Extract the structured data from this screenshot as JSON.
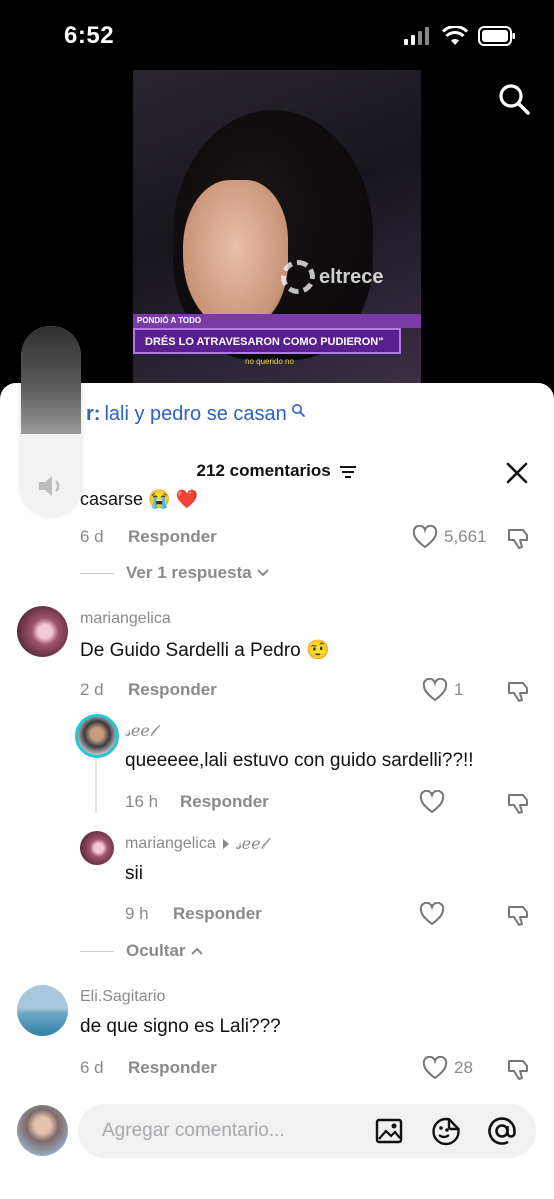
{
  "status_bar": {
    "time": "6:52"
  },
  "video": {
    "channel_logo": "eltrece",
    "banner_top": "PONDIÓ A TODO",
    "banner_main": "DRÉS LO ATRAVESARON COMO PUDIERON\"",
    "subtitle": "no querido no"
  },
  "volume": {
    "level": 0.43
  },
  "search_suggestion": {
    "prefix": "r:",
    "query": "lali y pedro se casan"
  },
  "sheet": {
    "title": "212 comentarios",
    "cut_text": "casarse 😭 ❤️"
  },
  "comments": [
    {
      "partial": true,
      "time": "6 d",
      "reply_label": "Responder",
      "likes": "5,661",
      "view_replies": "Ver 1 respuesta"
    },
    {
      "username": "mariangelica",
      "text": "De Guido Sardelli a Pedro 🤨",
      "time": "2 d",
      "reply_label": "Responder",
      "likes": "1",
      "replies": [
        {
          "username": "𝓈𝑒𝑒𝓁",
          "text": "queeeee,lali estuvo con guido sardelli??!!",
          "time": "16 h",
          "reply_label": "Responder",
          "likes": ""
        },
        {
          "username": "mariangelica",
          "reply_to": "𝓈𝑒𝑒𝓁",
          "text": "sii",
          "time": "9 h",
          "reply_label": "Responder",
          "likes": ""
        }
      ],
      "hide_label": "Ocultar"
    },
    {
      "username": "Eli.Sagitario",
      "text": "de que signo es Lali???",
      "time": "6 d",
      "reply_label": "Responder",
      "likes": "28"
    }
  ],
  "input": {
    "placeholder": "Agregar comentario..."
  },
  "icons": [
    "search-icon",
    "filter-icon",
    "close-icon",
    "heart-icon",
    "dislike-icon",
    "chevron-down-icon",
    "chevron-up-icon",
    "image-icon",
    "emoji-sticker-icon",
    "mention-icon",
    "speaker-icon"
  ]
}
